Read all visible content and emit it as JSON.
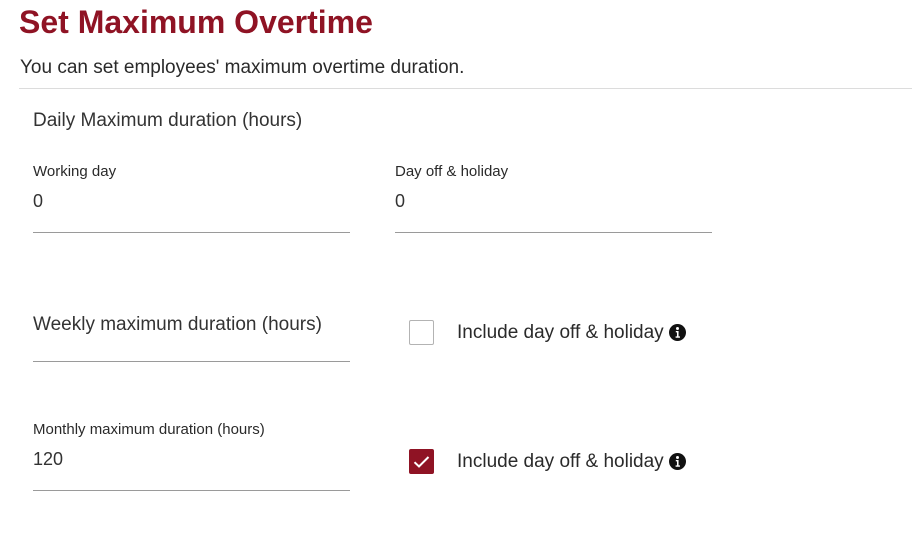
{
  "header": {
    "title": "Set Maximum Overtime",
    "subtitle": "You can set employees' maximum overtime duration."
  },
  "daily": {
    "section_label": "Daily Maximum duration (hours)",
    "working_day": {
      "label": "Working day",
      "value": "0"
    },
    "day_off_holiday": {
      "label": "Day off & holiday",
      "value": "0"
    }
  },
  "weekly": {
    "placeholder": "Weekly maximum duration (hours)",
    "value": "",
    "include_label": "Include day off & holiday",
    "include_checked": false
  },
  "monthly": {
    "label": "Monthly maximum duration (hours)",
    "value": "120",
    "include_label": "Include day off & holiday",
    "include_checked": true
  },
  "colors": {
    "accent": "#8f1324",
    "divider": "#dcdcdc",
    "underline": "#9a9a9a"
  },
  "icons": {
    "info": "info-circle-icon",
    "check": "checkmark-icon"
  }
}
